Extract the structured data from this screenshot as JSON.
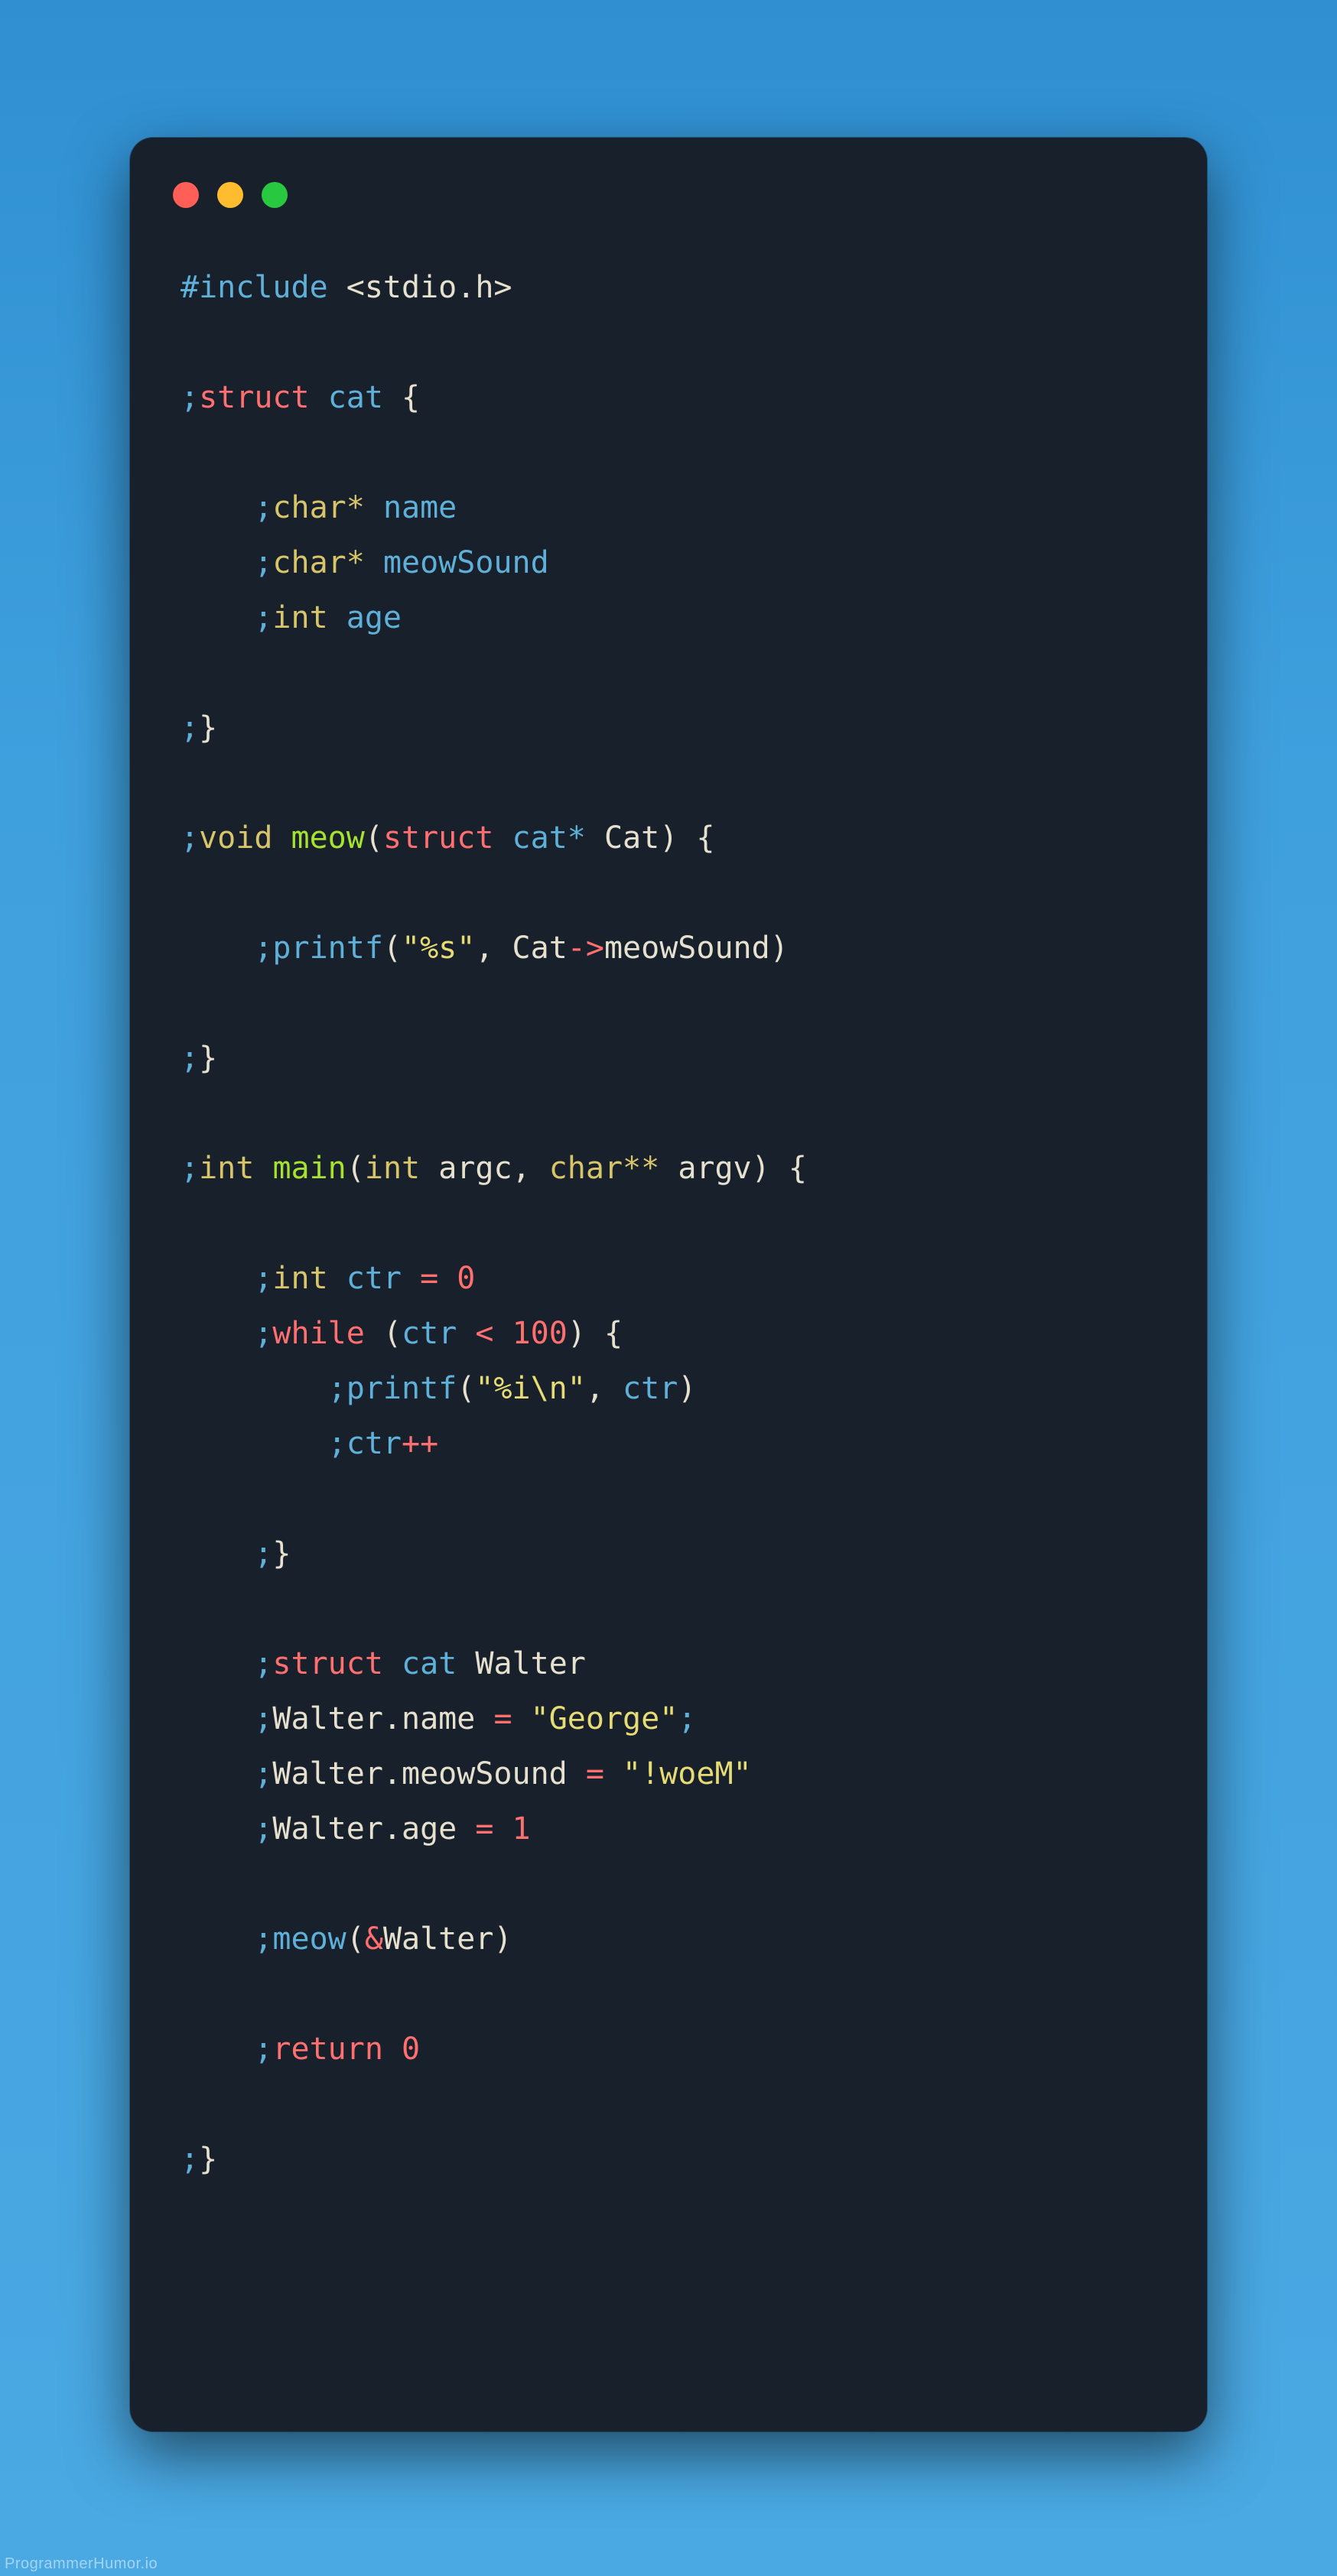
{
  "watermark": "ProgrammerHumor.io",
  "code": {
    "l1": {
      "include": "#include",
      "sp": " ",
      "hdr": "<stdio.h>"
    },
    "l3": {
      "semi": ";",
      "struct": "struct",
      "sp": " ",
      "name": "cat",
      "sp2": " ",
      "obr": "{"
    },
    "l5": {
      "indent": "    ",
      "semi": ";",
      "type": "char*",
      "sp": " ",
      "field": "name"
    },
    "l6": {
      "indent": "    ",
      "semi": ";",
      "type": "char*",
      "sp": " ",
      "field": "meowSound"
    },
    "l7": {
      "indent": "    ",
      "semi": ";",
      "type": "int",
      "sp": " ",
      "field": "age"
    },
    "l9": {
      "semi": ";",
      "cbr": "}"
    },
    "l11": {
      "semi": ";",
      "void": "void",
      "sp": " ",
      "fn": "meow",
      "open": "(",
      "struct": "struct",
      "sp2": " ",
      "name": "cat*",
      "sp3": " ",
      "param": "Cat",
      "close": ")",
      "sp4": " ",
      "obr": "{"
    },
    "l13": {
      "indent": "    ",
      "semi": ";",
      "fn": "printf",
      "open": "(",
      "str": "\"%s\"",
      "comma": ",",
      "sp": " ",
      "obj": "Cat",
      "arrow": "->",
      "prop": "meowSound",
      "close": ")"
    },
    "l15": {
      "semi": ";",
      "cbr": "}"
    },
    "l17": {
      "semi": ";",
      "int": "int",
      "sp": " ",
      "fn": "main",
      "open": "(",
      "t1": "int",
      "sp2": " ",
      "p1": "argc",
      "comma": ",",
      "sp3": " ",
      "t2": "char**",
      "sp4": " ",
      "p2": "argv",
      "close": ")",
      "sp5": " ",
      "obr": "{"
    },
    "l19": {
      "indent": "    ",
      "semi": ";",
      "type": "int",
      "sp": " ",
      "var": "ctr",
      "sp2": " ",
      "eq": "=",
      "sp3": " ",
      "num": "0"
    },
    "l20": {
      "indent": "    ",
      "semi": ";",
      "while": "while",
      "sp": " ",
      "open": "(",
      "var": "ctr",
      "sp2": " ",
      "op": "<",
      "sp3": " ",
      "num": "100",
      "close": ")",
      "sp4": " ",
      "obr": "{"
    },
    "l21": {
      "indent": "        ",
      "semi": ";",
      "fn": "printf",
      "open": "(",
      "str": "\"%i\\n\"",
      "comma": ",",
      "sp": " ",
      "var": "ctr",
      "close": ")"
    },
    "l22": {
      "indent": "        ",
      "semi": ";",
      "var": "ctr",
      "op": "++"
    },
    "l24": {
      "indent": "    ",
      "semi": ";",
      "cbr": "}"
    },
    "l26": {
      "indent": "    ",
      "semi": ";",
      "struct": "struct",
      "sp": " ",
      "name": "cat",
      "sp2": " ",
      "var": "Walter"
    },
    "l27": {
      "indent": "    ",
      "semi": ";",
      "var": "Walter",
      "dot": ".",
      "prop": "name",
      "sp": " ",
      "eq": "=",
      "sp2": " ",
      "str": "\"George\"",
      "trailsemi": ";"
    },
    "l28": {
      "indent": "    ",
      "semi": ";",
      "var": "Walter",
      "dot": ".",
      "prop": "meowSound",
      "sp": " ",
      "eq": "=",
      "sp2": " ",
      "str": "\"!woeM\""
    },
    "l29": {
      "indent": "    ",
      "semi": ";",
      "var": "Walter",
      "dot": ".",
      "prop": "age",
      "sp": " ",
      "eq": "=",
      "sp2": " ",
      "num": "1"
    },
    "l31": {
      "indent": "    ",
      "semi": ";",
      "fn": "meow",
      "open": "(",
      "amp": "&",
      "var": "Walter",
      "close": ")"
    },
    "l33": {
      "indent": "    ",
      "semi": ";",
      "return": "return",
      "sp": " ",
      "num": "0"
    },
    "l35": {
      "semi": ";",
      "cbr": "}"
    }
  }
}
